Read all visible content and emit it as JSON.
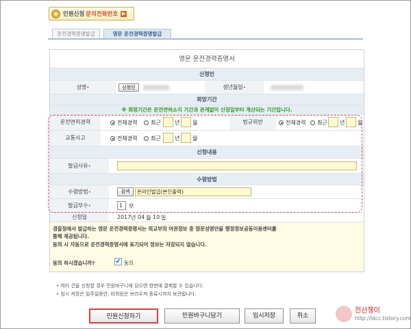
{
  "inquiry": {
    "label1": "민원신청",
    "label2": "문의전화번호"
  },
  "tabs": [
    {
      "label": "운전경력증명발급"
    },
    {
      "label": "영문 운전경력증명발급"
    }
  ],
  "form": {
    "title": "영문 운전경력증명서",
    "applicant": {
      "section": "신청인",
      "name_label": "성명",
      "applicant_button": "신청인",
      "birth_label": "생년월일"
    },
    "period": {
      "section": "희망기간",
      "notice": "※ 희망기간은 운전면허소지 기간과 관계없이 신청일부터 계산되는 기간입니다.",
      "rows": [
        {
          "label": "운전면허경력",
          "all": "전체경력",
          "recent": "최근",
          "year": "년",
          "month": "월"
        },
        {
          "label": "법규위반",
          "all": "전체경력",
          "recent": "최근",
          "year": "년",
          "month": "월"
        },
        {
          "label": "교통사고",
          "all": "전체경력",
          "recent": "최근",
          "year": "년",
          "month": "월"
        }
      ]
    },
    "content": {
      "section": "신청내용",
      "reason_label": "발급사유"
    },
    "receive": {
      "section": "수령방법",
      "method_label": "수령방법",
      "search_button": "검색",
      "method_value": "온라인발급(본인출력)",
      "copies_label": "발급부수",
      "copies_value": "1",
      "copies_unit": "부"
    },
    "apply_date": {
      "label": "신청일",
      "year": "2017",
      "year_unit": "년",
      "month": "04",
      "month_unit": "월",
      "day": "10",
      "day_unit": "일"
    },
    "consent": {
      "text1": "경찰청에서 발급하는 영문 운전경력증명서는 외교부의 여권정보 중 영문성명만을 행정정보공동이용센터를",
      "text2": "통해 제공됩니다.",
      "text3": "동의 시 자동으로 운전경력증명서에 표기되어 정보는 저장되지 않습니다.",
      "question": "동의 하시겠습니까?",
      "agree": "동의"
    }
  },
  "notes": [
    "• 여러 건을 신청할 경우 민원바구니에 담으면 한번에 결제할 수 있습니다.",
    "• 임시 저장은 일주일동안, 비회원은 브라우져 종료시까지 보관됩니다."
  ],
  "buttons": {
    "submit": "민원신청하기",
    "basket": "민원바구니담기",
    "temp_save": "임시저장",
    "cancel": "취소"
  },
  "watermark": {
    "name": "전산쟁이",
    "url": "http://ldcc.tistory.com"
  }
}
